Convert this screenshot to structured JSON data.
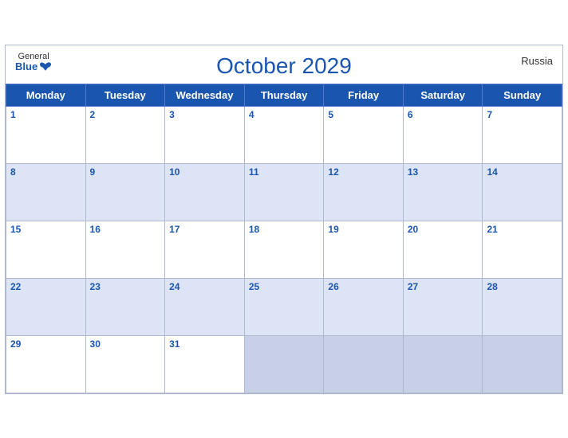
{
  "calendar": {
    "title": "October 2029",
    "country": "Russia",
    "logo": {
      "general": "General",
      "blue": "Blue"
    },
    "days_of_week": [
      "Monday",
      "Tuesday",
      "Wednesday",
      "Thursday",
      "Friday",
      "Saturday",
      "Sunday"
    ],
    "weeks": [
      [
        1,
        2,
        3,
        4,
        5,
        6,
        7
      ],
      [
        8,
        9,
        10,
        11,
        12,
        13,
        14
      ],
      [
        15,
        16,
        17,
        18,
        19,
        20,
        21
      ],
      [
        22,
        23,
        24,
        25,
        26,
        27,
        28
      ],
      [
        29,
        30,
        31,
        null,
        null,
        null,
        null
      ]
    ]
  }
}
